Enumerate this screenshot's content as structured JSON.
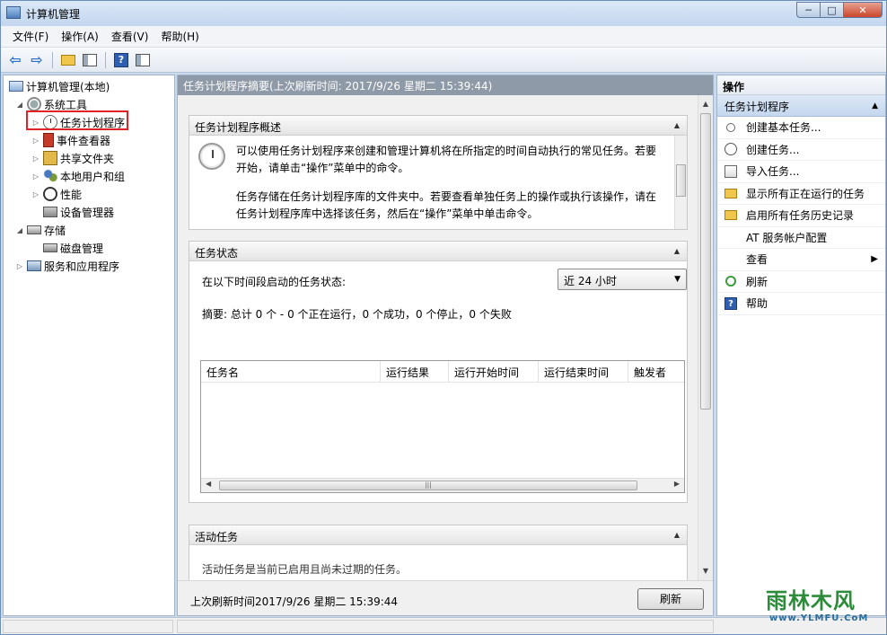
{
  "window": {
    "title": "计算机管理",
    "controls": {
      "minimize": "─",
      "maximize": "□",
      "close": "✕"
    }
  },
  "menu": [
    "文件(F)",
    "操作(A)",
    "查看(V)",
    "帮助(H)"
  ],
  "toolbar": {
    "back": "⇦",
    "forward": "⇨",
    "help": "?"
  },
  "tree": {
    "root": "计算机管理(本地)",
    "system_tools": "系统工具",
    "task_scheduler": "任务计划程序",
    "event_viewer": "事件查看器",
    "shared_folders": "共享文件夹",
    "local_users": "本地用户和组",
    "performance": "性能",
    "device_manager": "设备管理器",
    "storage": "存储",
    "disk_management": "磁盘管理",
    "services_apps": "服务和应用程序",
    "twisty_open": "◢",
    "twisty_closed": "▷"
  },
  "center": {
    "header": "任务计划程序摘要(上次刷新时间: 2017/9/26 星期二 15:39:44)",
    "overview": {
      "title": "任务计划程序概述",
      "para1_line1": "可以使用任务计划程序来创建和管理计算机将在所指定的时间自动执行的常见任务。若要",
      "para1_line2": "开始，请单击“操作”菜单中的命令。",
      "para2_line1": "任务存储在任务计划程序库的文件夹中。若要查看单独任务上的操作或执行该操作，请在",
      "para2_line2": "任务计划程序库中选择该任务，然后在“操作”菜单中单击命令。"
    },
    "status": {
      "title": "任务状态",
      "period_label": "在以下时间段启动的任务状态:",
      "period_value": "近 24 小时",
      "summary": "摘要: 总计 0 个 - 0 个正在运行，0 个成功，0 个停止，0 个失败",
      "columns": [
        "任务名",
        "运行结果",
        "运行开始时间",
        "运行结束时间",
        "触发者"
      ]
    },
    "active": {
      "title": "活动任务",
      "text": "活动任务是当前已启用且尚未过期的任务。"
    },
    "footer_text": "上次刷新时间2017/9/26 星期二 15:39:44",
    "refresh_label": "刷新"
  },
  "actions": {
    "title": "操作",
    "group": "任务计划程序",
    "items": [
      {
        "label": "创建基本任务...",
        "icon": "basic-task-icon"
      },
      {
        "label": "创建任务...",
        "icon": "task-icon"
      },
      {
        "label": "导入任务...",
        "icon": "import-icon"
      },
      {
        "label": "显示所有正在运行的任务",
        "icon": "folder-icon"
      },
      {
        "label": "启用所有任务历史记录",
        "icon": "folder-icon"
      },
      {
        "label": "AT 服务帐户配置",
        "icon": "none"
      },
      {
        "label": "查看",
        "icon": "none"
      },
      {
        "label": "刷新",
        "icon": "refresh-icon"
      },
      {
        "label": "帮助",
        "icon": "help-icon"
      }
    ]
  },
  "watermark": {
    "name": "雨林木风",
    "url": "www.YLMFU.CoM"
  },
  "colors": {
    "highlight_box": "#e02424",
    "header_gray": "#8f9aa8",
    "action_group": "#c4d7ee"
  }
}
